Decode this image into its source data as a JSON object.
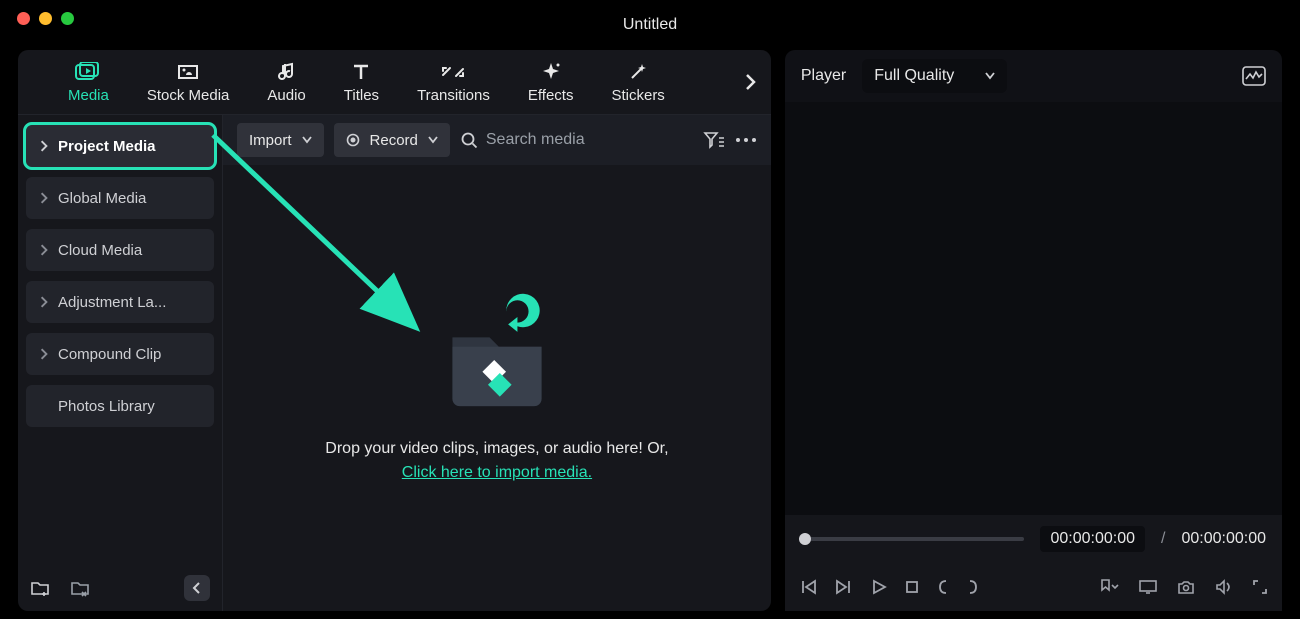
{
  "window": {
    "title": "Untitled"
  },
  "colors": {
    "accent": "#27e2b6",
    "traffic_red": "#ff5f56",
    "traffic_yellow": "#ffbd2e",
    "traffic_green": "#27c93f"
  },
  "tabs": {
    "media": "Media",
    "stock_media": "Stock Media",
    "audio": "Audio",
    "titles": "Titles",
    "transitions": "Transitions",
    "effects": "Effects",
    "stickers": "Stickers"
  },
  "sidebar": {
    "items": [
      {
        "label": "Project Media",
        "has_children": true,
        "highlight": true
      },
      {
        "label": "Global Media",
        "has_children": true
      },
      {
        "label": "Cloud Media",
        "has_children": true
      },
      {
        "label": "Adjustment La...",
        "has_children": true
      },
      {
        "label": "Compound Clip",
        "has_children": true
      },
      {
        "label": "Photos Library",
        "has_children": false
      }
    ]
  },
  "toolbar": {
    "import": "Import",
    "record": "Record",
    "search_placeholder": "Search media"
  },
  "dropzone": {
    "line1": "Drop your video clips, images, or audio here! Or,",
    "link": "Click here to import media."
  },
  "player": {
    "label": "Player",
    "quality": "Full Quality",
    "current": "00:00:00:00",
    "separator": "/",
    "duration": "00:00:00:00"
  }
}
